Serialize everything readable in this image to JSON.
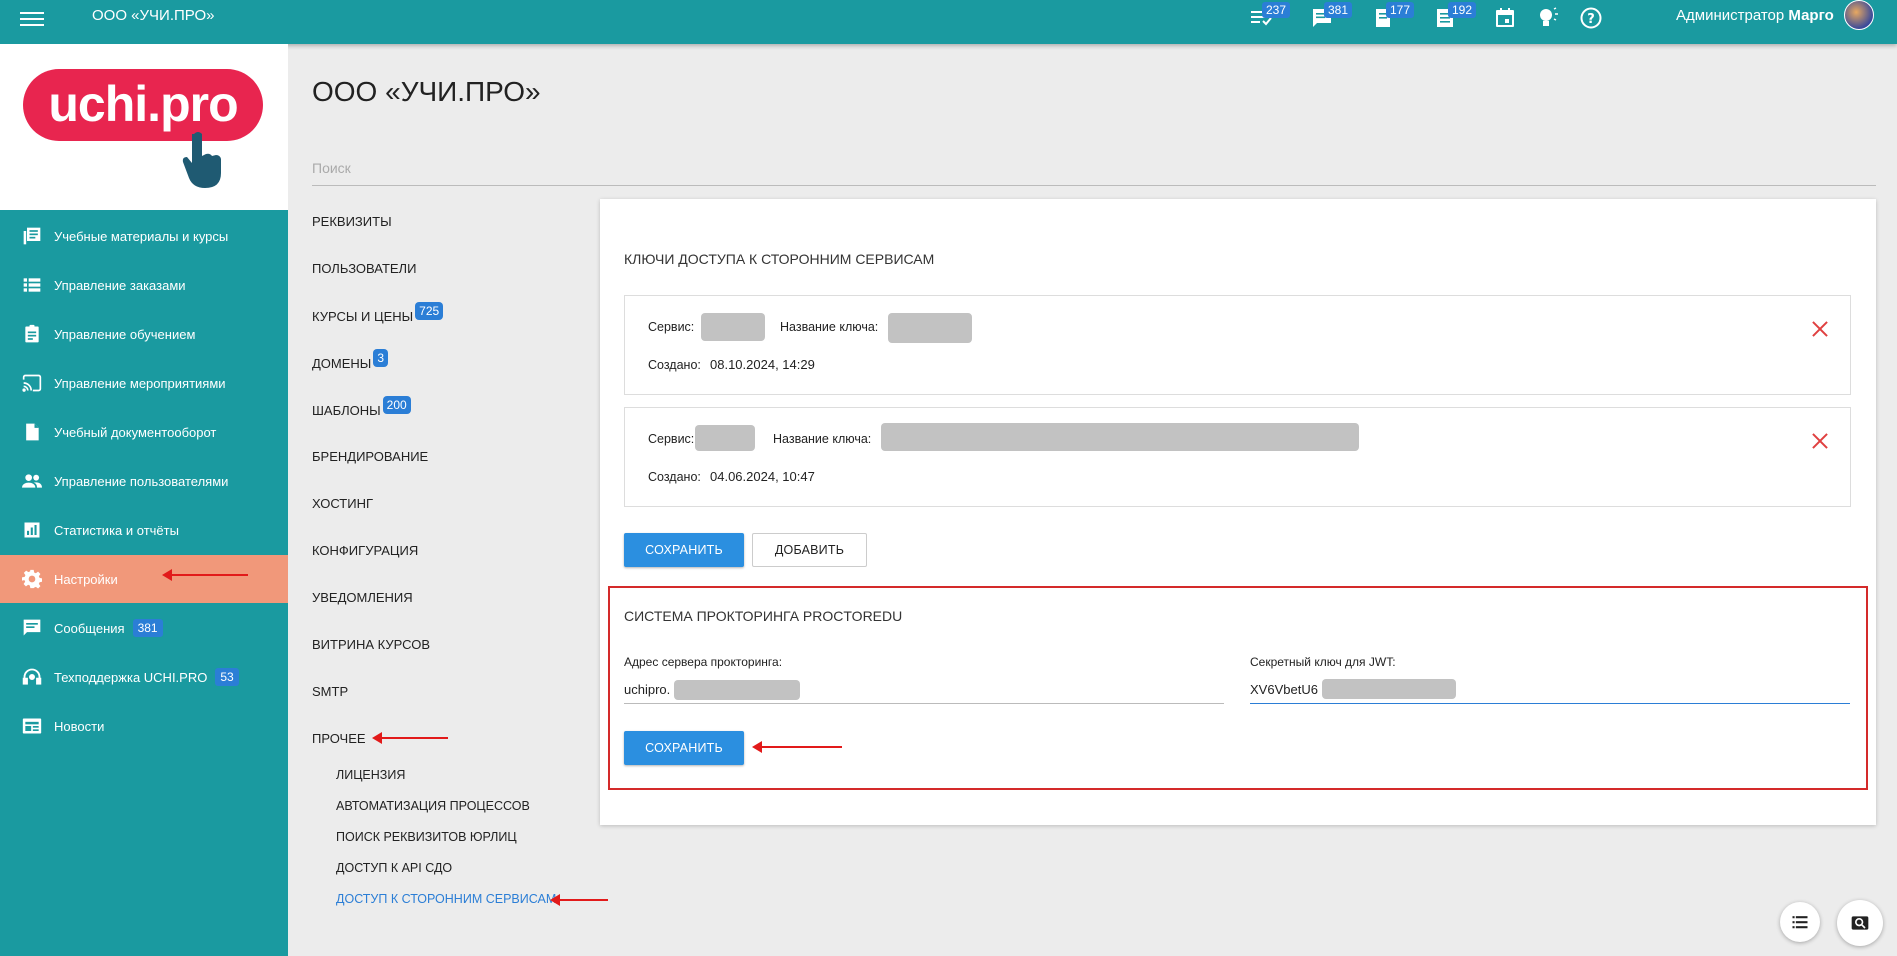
{
  "topbar": {
    "title": "ООО «УЧИ.ПРО»",
    "icons": [
      {
        "name": "tasks-icon",
        "badge": "237"
      },
      {
        "name": "messages-icon",
        "badge": "381"
      },
      {
        "name": "documents-icon",
        "badge": "177"
      },
      {
        "name": "list-icon",
        "badge": "192"
      },
      {
        "name": "calendar-icon",
        "badge": ""
      },
      {
        "name": "lightbulb-icon",
        "badge": ""
      },
      {
        "name": "help-icon",
        "badge": ""
      }
    ],
    "user_role": "Администратор",
    "user_name": "Марго"
  },
  "logo": {
    "text": "uchi.pro",
    "color": "#e8254f"
  },
  "sidebar": {
    "items": [
      {
        "label": "Учебные материалы и курсы",
        "icon": "library-icon",
        "badge": ""
      },
      {
        "label": "Управление заказами",
        "icon": "list-icon",
        "badge": ""
      },
      {
        "label": "Управление обучением",
        "icon": "clipboard-icon",
        "badge": ""
      },
      {
        "label": "Управление мероприятиями",
        "icon": "cast-icon",
        "badge": ""
      },
      {
        "label": "Учебный документооборот",
        "icon": "document-icon",
        "badge": ""
      },
      {
        "label": "Управление пользователями",
        "icon": "people-icon",
        "badge": ""
      },
      {
        "label": "Статистика и отчёты",
        "icon": "chart-icon",
        "badge": ""
      },
      {
        "label": "Настройки",
        "icon": "gear-icon",
        "badge": "",
        "active": true
      },
      {
        "label": "Сообщения",
        "icon": "chat-icon",
        "badge": "381"
      },
      {
        "label": "Техподдержка UCHI.PRO",
        "icon": "headset-icon",
        "badge": "53"
      },
      {
        "label": "Новости",
        "icon": "news-icon",
        "badge": ""
      }
    ]
  },
  "page": {
    "title": "ООО «УЧИ.ПРО»",
    "search_placeholder": "Поиск"
  },
  "settings_menu": {
    "items": [
      {
        "label": "РЕКВИЗИТЫ",
        "badge": ""
      },
      {
        "label": "ПОЛЬЗОВАТЕЛИ",
        "badge": ""
      },
      {
        "label": "КУРСЫ И ЦЕНЫ",
        "badge": "725"
      },
      {
        "label": "ДОМЕНЫ",
        "badge": "3"
      },
      {
        "label": "ШАБЛОНЫ",
        "badge": "200"
      },
      {
        "label": "БРЕНДИРОВАНИЕ",
        "badge": ""
      },
      {
        "label": "ХОСТИНГ",
        "badge": ""
      },
      {
        "label": "КОНФИГУРАЦИЯ",
        "badge": ""
      },
      {
        "label": "УВЕДОМЛЕНИЯ",
        "badge": ""
      },
      {
        "label": "ВИТРИНА КУРСОВ",
        "badge": ""
      },
      {
        "label": "SMTP",
        "badge": ""
      },
      {
        "label": "ПРОЧЕЕ",
        "badge": ""
      }
    ],
    "sub_items": [
      {
        "label": "ЛИЦЕНЗИЯ"
      },
      {
        "label": "АВТОМАТИЗАЦИЯ ПРОЦЕССОВ"
      },
      {
        "label": "ПОИСК РЕКВИЗИТОВ ЮРЛИЦ"
      },
      {
        "label": "ДОСТУП К API СДО"
      },
      {
        "label": "ДОСТУП К СТОРОННИМ СЕРВИСАМ",
        "active": true
      }
    ]
  },
  "access_keys": {
    "heading": "КЛЮЧИ ДОСТУПА К СТОРОННИМ СЕРВИСАМ",
    "service_label": "Сервис:",
    "key_name_label": "Название ключа:",
    "created_label": "Создано:",
    "keys": [
      {
        "created": "08.10.2024, 14:29"
      },
      {
        "created": "04.06.2024, 10:47"
      }
    ],
    "save_label": "СОХРАНИТЬ",
    "add_label": "ДОБАВИТЬ"
  },
  "proctoring": {
    "heading": "СИСТЕМА ПРОКТОРИНГА PROCTOREDU",
    "server_label": "Адрес сервера прокторинга:",
    "server_value": "uchipro.",
    "secret_label": "Секретный ключ для JWT:",
    "secret_value": "XV6VbetU6",
    "save_label": "СОХРАНИТЬ"
  },
  "colors": {
    "brand_teal": "#1a9aa0",
    "active_item": "#f1987a",
    "primary_button": "#2b8fe0",
    "annotation_red": "#e21a1a"
  }
}
